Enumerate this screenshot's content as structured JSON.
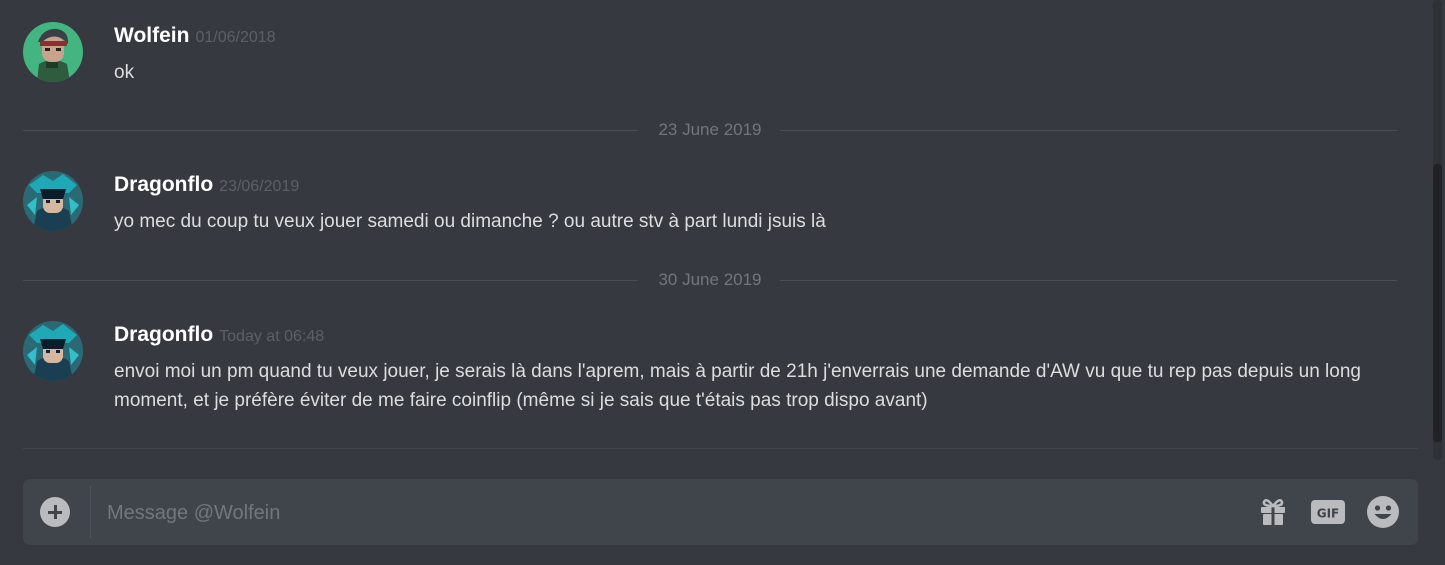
{
  "messages": [
    {
      "author": "Wolfein",
      "timestamp": "01/06/2018",
      "text": "ok",
      "avatar_icon": "wolfein-avatar",
      "avatar_bg": "#43b581"
    },
    {
      "author": "Dragonflo",
      "timestamp": "23/06/2019",
      "text": "yo mec du coup tu veux jouer samedi ou dimanche ? ou autre stv à part lundi jsuis là",
      "avatar_icon": "dragonflo-avatar",
      "avatar_bg": "#2b6a74"
    },
    {
      "author": "Dragonflo",
      "timestamp": "Today at 06:48",
      "text": "envoi moi un pm quand tu veux jouer, je serais là dans l'aprem, mais à partir de 21h j'enverrais une demande d'AW vu que tu rep pas depuis un long moment, et je préfère éviter de me faire coinflip (même si je sais que t'étais pas trop dispo avant)",
      "avatar_icon": "dragonflo-avatar",
      "avatar_bg": "#2b6a74"
    }
  ],
  "dividers": [
    "23 June 2019",
    "30 June 2019"
  ],
  "composer": {
    "placeholder": "Message @Wolfein",
    "gif_label": "GIF"
  },
  "colors": {
    "background": "#36393f",
    "composer": "#40444b",
    "author": "#ffffff",
    "text": "#dcddde",
    "muted": "#72767d"
  },
  "icons": [
    "add-attachment-icon",
    "gift-icon",
    "gif-icon",
    "emoji-icon"
  ]
}
